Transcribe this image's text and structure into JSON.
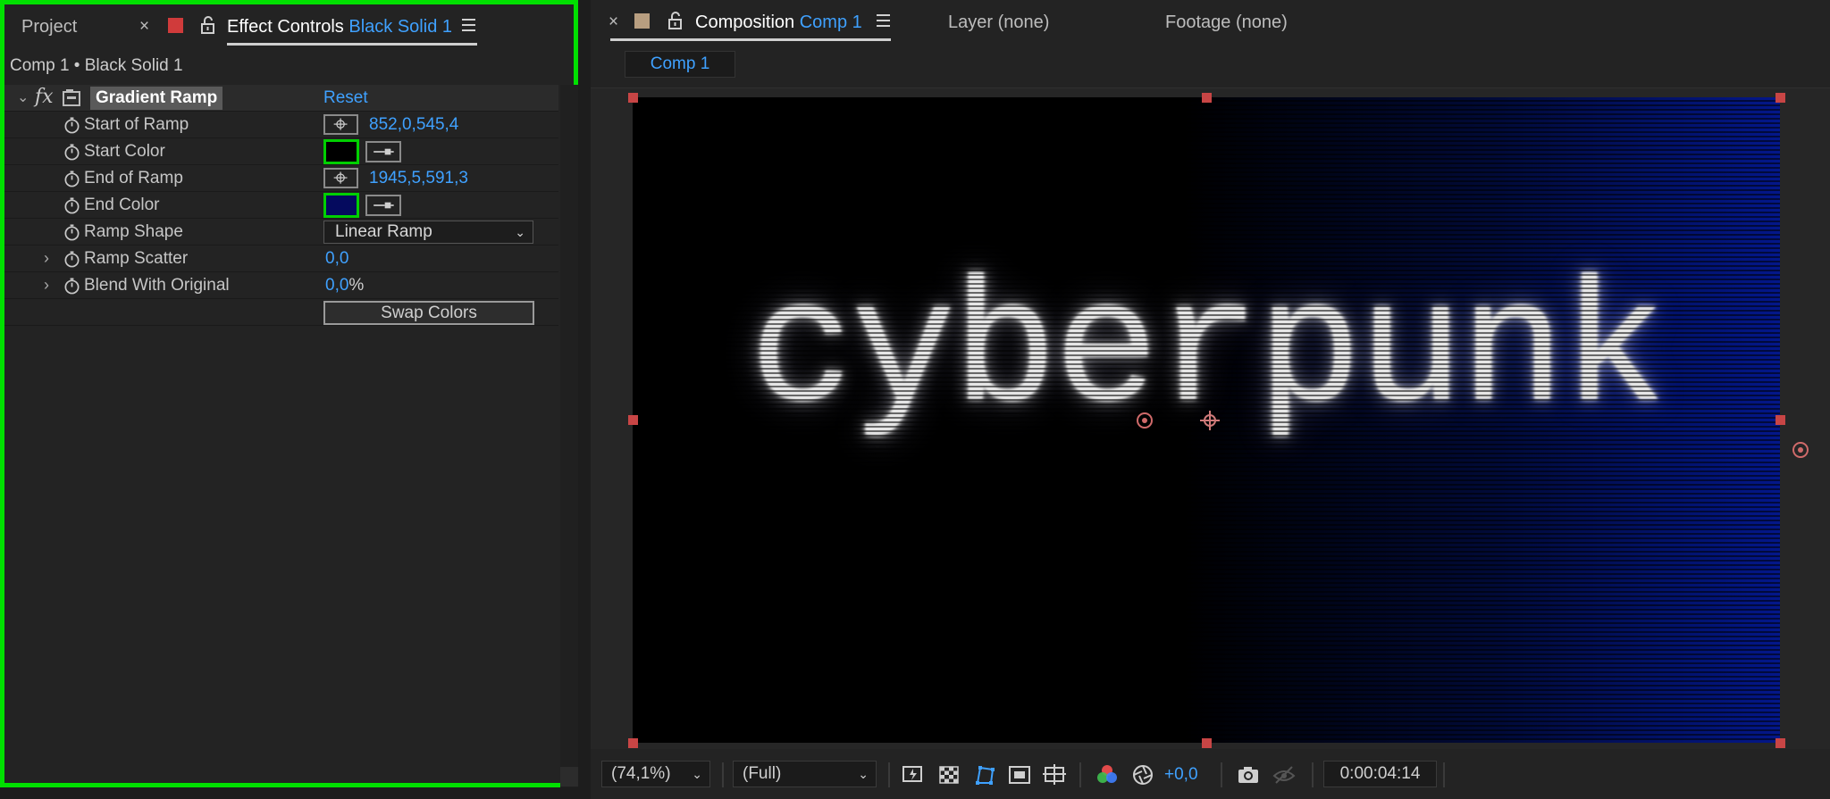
{
  "left_panel": {
    "tabs": {
      "project": "Project",
      "effect_controls_prefix": "Effect Controls",
      "effect_controls_layer": "Black Solid 1"
    },
    "layer_path": "Comp 1 • Black Solid 1",
    "effect": {
      "name": "Gradient Ramp",
      "reset_label": "Reset",
      "properties": {
        "start_of_ramp": {
          "label": "Start of Ramp",
          "value": "852,0,545,4"
        },
        "start_color": {
          "label": "Start Color",
          "color": "#000000"
        },
        "end_of_ramp": {
          "label": "End of Ramp",
          "value": "1945,5,591,3"
        },
        "end_color": {
          "label": "End Color",
          "color": "#050a5e"
        },
        "ramp_shape": {
          "label": "Ramp Shape",
          "value": "Linear Ramp"
        },
        "ramp_scatter": {
          "label": "Ramp Scatter",
          "value": "0,0"
        },
        "blend_with_original": {
          "label": "Blend With Original",
          "value": "0,0",
          "unit": "%"
        }
      },
      "swap_colors_label": "Swap Colors"
    },
    "highlight_color": "#00e000"
  },
  "right_panel": {
    "tabs": {
      "composition_prefix": "Composition",
      "composition_name": "Comp 1",
      "layer": "Layer (none)",
      "footage": "Footage (none)"
    },
    "breadcrumb": "Comp 1",
    "canvas_text": "cyberpunk",
    "footer": {
      "zoom": "(74,1%)",
      "resolution": "(Full)",
      "exposure": "+0,0",
      "timecode": "0:00:04:14"
    }
  },
  "colors": {
    "accent_blue": "#3fa1ff",
    "handle_red": "#c84545",
    "ramp_end": "#03178a"
  }
}
